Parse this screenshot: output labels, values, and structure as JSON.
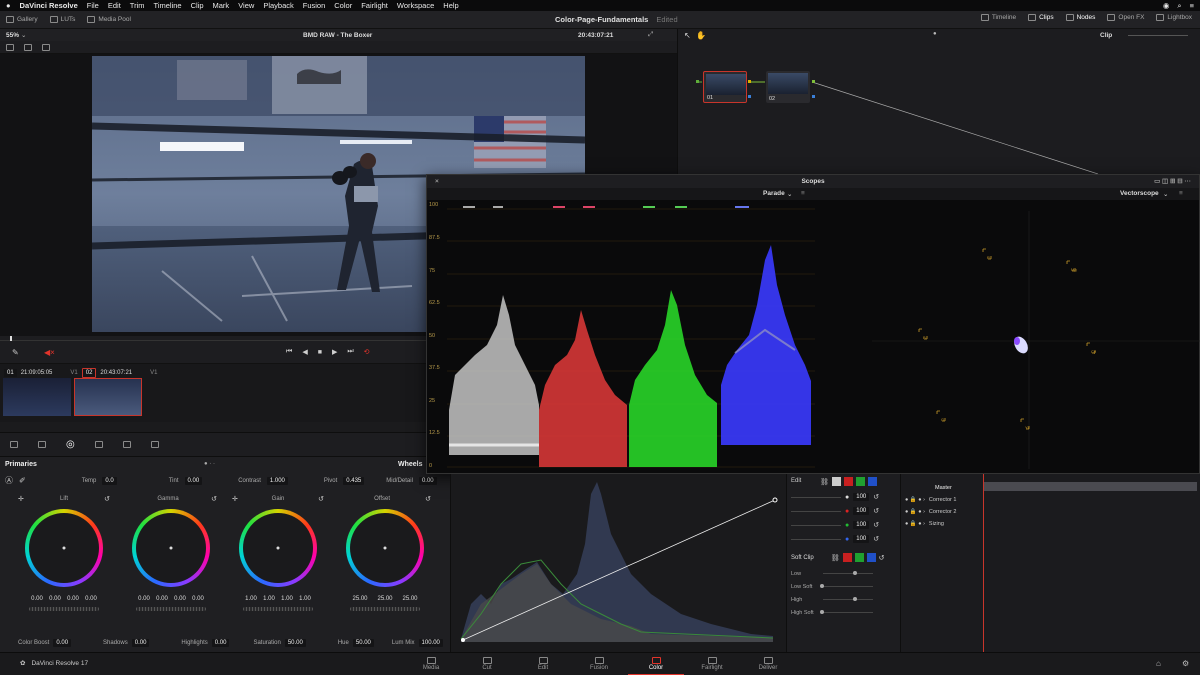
{
  "menubar": {
    "app": "DaVinci Resolve",
    "items": [
      "File",
      "Edit",
      "Trim",
      "Timeline",
      "Clip",
      "Mark",
      "View",
      "Playback",
      "Fusion",
      "Color",
      "Fairlight",
      "Workspace",
      "Help"
    ]
  },
  "toolbar": {
    "left": [
      "Gallery",
      "LUTs",
      "Media Pool"
    ],
    "project": "Color-Page-Fundamentals",
    "edited": "Edited",
    "right": [
      "Timeline",
      "Clips",
      "Nodes",
      "Open FX",
      "Lightbox"
    ]
  },
  "viewer": {
    "zoom": "55%",
    "clip_name": "BMD RAW - The Boxer",
    "timecode": "20:43:07:21",
    "node_mode": "Clip"
  },
  "clips": [
    {
      "num": "01",
      "tc": "21:09:05:05",
      "track": "V1"
    },
    {
      "num": "02",
      "tc": "20:43:07:21",
      "track": "V1"
    }
  ],
  "primaries": {
    "title": "Primaries",
    "mode": "Wheels",
    "temp_label": "Temp",
    "temp": "0.0",
    "tint_label": "Tint",
    "tint": "0.00",
    "contrast_label": "Contrast",
    "contrast": "1.000",
    "pivot_label": "Pivot",
    "pivot": "0.435",
    "middetail_label": "Mid/Detail",
    "middetail": "0.00",
    "wheels": [
      {
        "name": "Lift",
        "values": [
          "0.00",
          "0.00",
          "0.00",
          "0.00"
        ]
      },
      {
        "name": "Gamma",
        "values": [
          "0.00",
          "0.00",
          "0.00",
          "0.00"
        ]
      },
      {
        "name": "Gain",
        "values": [
          "1.00",
          "1.00",
          "1.00",
          "1.00"
        ]
      },
      {
        "name": "Offset",
        "values": [
          "25.00",
          "25.00",
          "25.00"
        ]
      }
    ],
    "bottom": [
      {
        "label": "Color Boost",
        "value": "0.00"
      },
      {
        "label": "Shadows",
        "value": "0.00"
      },
      {
        "label": "Highlights",
        "value": "0.00"
      },
      {
        "label": "Saturation",
        "value": "50.00"
      },
      {
        "label": "Hue",
        "value": "50.00"
      },
      {
        "label": "Lum Mix",
        "value": "100.00"
      }
    ]
  },
  "nodes": [
    {
      "label": "01"
    },
    {
      "label": "02"
    }
  ],
  "scopes": {
    "title": "Scopes",
    "left_mode": "Parade",
    "right_mode": "Vectorscope",
    "ticks": [
      "100",
      "87.5",
      "75",
      "62.5",
      "50",
      "37.5",
      "25",
      "12.5",
      "0"
    ],
    "vector_targets": [
      "R",
      "Mg",
      "B",
      "Cy",
      "G",
      "Yl"
    ]
  },
  "edit": {
    "title": "Edit",
    "values": [
      "100",
      "100",
      "100",
      "100"
    ],
    "softclip": "Soft Clip",
    "soft_labels": [
      "Low",
      "Low Soft",
      "High",
      "High Soft"
    ]
  },
  "keyframes": {
    "tracks": [
      "Master",
      "Corrector 1",
      "Corrector 2",
      "Sizing"
    ]
  },
  "pages": [
    "Media",
    "Cut",
    "Edit",
    "Fusion",
    "Color",
    "Fairlight",
    "Deliver"
  ],
  "footer_app": "DaVinci Resolve 17",
  "colors": {
    "accent": "#e2342b",
    "selected_outline": "#c8352b"
  }
}
